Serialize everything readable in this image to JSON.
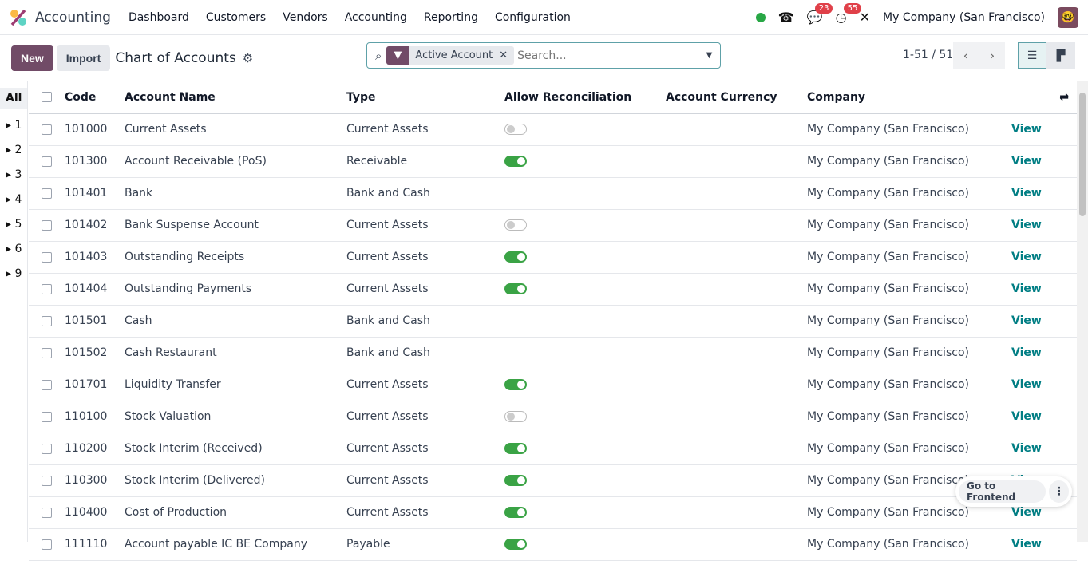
{
  "navbar": {
    "app": "Accounting",
    "menu": [
      "Dashboard",
      "Customers",
      "Vendors",
      "Accounting",
      "Reporting",
      "Configuration"
    ],
    "messages_badge": "23",
    "activities_badge": "55",
    "company": "My Company (San Francisco)"
  },
  "control": {
    "new": "New",
    "import": "Import",
    "title": "Chart of Accounts",
    "facet": "Active Account",
    "search_placeholder": "Search...",
    "pager": "1-51 / 51"
  },
  "groups": [
    "All",
    "1",
    "2",
    "3",
    "4",
    "5",
    "6",
    "9"
  ],
  "columns": [
    "Code",
    "Account Name",
    "Type",
    "Allow Reconciliation",
    "Account Currency",
    "Company"
  ],
  "view_label": "View",
  "rows": [
    {
      "code": "101000",
      "name": "Current Assets",
      "type": "Current Assets",
      "reconcile": false,
      "company": "My Company (San Francisco)"
    },
    {
      "code": "101300",
      "name": "Account Receivable (PoS)",
      "type": "Receivable",
      "reconcile": true,
      "company": "My Company (San Francisco)"
    },
    {
      "code": "101401",
      "name": "Bank",
      "type": "Bank and Cash",
      "reconcile": null,
      "company": "My Company (San Francisco)"
    },
    {
      "code": "101402",
      "name": "Bank Suspense Account",
      "type": "Current Assets",
      "reconcile": false,
      "company": "My Company (San Francisco)"
    },
    {
      "code": "101403",
      "name": "Outstanding Receipts",
      "type": "Current Assets",
      "reconcile": true,
      "company": "My Company (San Francisco)"
    },
    {
      "code": "101404",
      "name": "Outstanding Payments",
      "type": "Current Assets",
      "reconcile": true,
      "company": "My Company (San Francisco)"
    },
    {
      "code": "101501",
      "name": "Cash",
      "type": "Bank and Cash",
      "reconcile": null,
      "company": "My Company (San Francisco)"
    },
    {
      "code": "101502",
      "name": "Cash Restaurant",
      "type": "Bank and Cash",
      "reconcile": null,
      "company": "My Company (San Francisco)"
    },
    {
      "code": "101701",
      "name": "Liquidity Transfer",
      "type": "Current Assets",
      "reconcile": true,
      "company": "My Company (San Francisco)"
    },
    {
      "code": "110100",
      "name": "Stock Valuation",
      "type": "Current Assets",
      "reconcile": false,
      "company": "My Company (San Francisco)"
    },
    {
      "code": "110200",
      "name": "Stock Interim (Received)",
      "type": "Current Assets",
      "reconcile": true,
      "company": "My Company (San Francisco)"
    },
    {
      "code": "110300",
      "name": "Stock Interim (Delivered)",
      "type": "Current Assets",
      "reconcile": true,
      "company": "My Company (San Francisco)"
    },
    {
      "code": "110400",
      "name": "Cost of Production",
      "type": "Current Assets",
      "reconcile": true,
      "company": "My Company (San Francisco)"
    },
    {
      "code": "111110",
      "name": "Account payable IC BE Company",
      "type": "Payable",
      "reconcile": true,
      "company": "My Company (San Francisco)"
    }
  ],
  "frontend": {
    "label": "Go to Frontend"
  },
  "colors": {
    "primary": "#714b67",
    "toggle_on": "#3aa345",
    "link": "#017e84"
  }
}
